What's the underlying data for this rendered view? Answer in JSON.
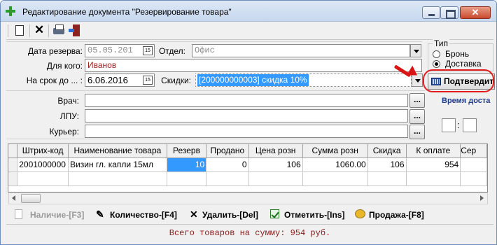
{
  "window": {
    "title": "Редактирование документа  \"Резервирование товара\"",
    "close_glyph": "✕"
  },
  "form": {
    "reserve_date_label": "Дата резерва:",
    "reserve_date_value": "05.05.201",
    "department_label": "Отдел:",
    "department_value": "Офис",
    "for_whom_label": "Для кого:",
    "for_whom_value": "Иванов",
    "term_label": "На срок до ... :",
    "term_value": "6.06.2016",
    "discounts_label": "Скидки:",
    "discounts_value": "[200000000003] скидка 10%",
    "doctor_label": "Врач:",
    "doctor_value": "",
    "lpu_label": "ЛПУ:",
    "lpu_value": "",
    "courier_label": "Курьер:",
    "courier_value": "",
    "dots_label": "..."
  },
  "type_group": {
    "title": "Тип",
    "options": [
      {
        "label": "Бронь",
        "checked": false
      },
      {
        "label": "Доставка",
        "checked": true
      }
    ]
  },
  "confirm_button_label": "Подтвердит",
  "delivery_time_label": "Время доста",
  "time_colon": ":",
  "grid": {
    "columns": [
      "Штрих-код",
      "Наименование товара",
      "Резерв",
      "Продано",
      "Цена розн",
      "Сумма розн",
      "Скидка",
      "К оплате",
      "Сер"
    ],
    "rows": [
      [
        "2001000000",
        "Визин гл. капли 15мл",
        "10",
        "0",
        "106",
        "1060.00",
        "106",
        "954",
        ""
      ]
    ]
  },
  "actions": {
    "availability": "Наличие-[F3]",
    "quantity": "Количество-[F4]",
    "delete": "Удалить-[Del]",
    "mark": "Отметить-[Ins]",
    "sale": "Продажа-[F8]"
  },
  "status": {
    "total_text": "Всего товаров на сумму: 954 руб."
  }
}
